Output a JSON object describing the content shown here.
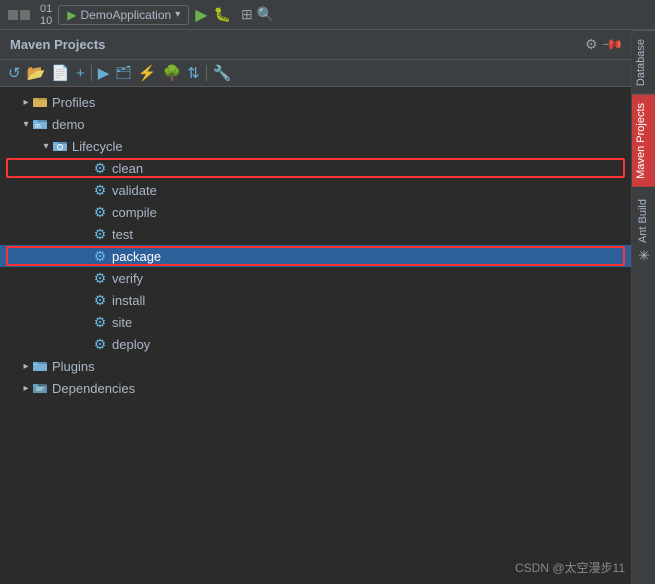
{
  "topbar": {
    "app_name": "DemoApplication",
    "run_label": "▶",
    "debug_label": "🐞"
  },
  "panel": {
    "title": "Maven Projects",
    "gear_label": "⚙",
    "pin_label": "📌"
  },
  "toolbar": {
    "icons": [
      "↺",
      "📂",
      "📄",
      "+",
      "▶",
      "🗂",
      "⚡",
      "🔄",
      "🌳",
      "⇅",
      "🔧"
    ]
  },
  "tree": {
    "items": [
      {
        "id": "profiles",
        "label": "Profiles",
        "indent": 1,
        "type": "folder-profiles",
        "arrow": "closed"
      },
      {
        "id": "demo",
        "label": "demo",
        "indent": 1,
        "type": "folder-demo",
        "arrow": "open"
      },
      {
        "id": "lifecycle",
        "label": "Lifecycle",
        "indent": 2,
        "type": "folder-lifecycle",
        "arrow": "open"
      },
      {
        "id": "clean",
        "label": "clean",
        "indent": 4,
        "type": "gear",
        "arrow": "none",
        "highlight": true
      },
      {
        "id": "validate",
        "label": "validate",
        "indent": 4,
        "type": "gear",
        "arrow": "none"
      },
      {
        "id": "compile",
        "label": "compile",
        "indent": 4,
        "type": "gear",
        "arrow": "none"
      },
      {
        "id": "test",
        "label": "test",
        "indent": 4,
        "type": "gear",
        "arrow": "none"
      },
      {
        "id": "package",
        "label": "package",
        "indent": 4,
        "type": "gear",
        "arrow": "none",
        "selected": true,
        "highlight": true
      },
      {
        "id": "verify",
        "label": "verify",
        "indent": 4,
        "type": "gear",
        "arrow": "none"
      },
      {
        "id": "install",
        "label": "install",
        "indent": 4,
        "type": "gear",
        "arrow": "none"
      },
      {
        "id": "site",
        "label": "site",
        "indent": 4,
        "type": "gear",
        "arrow": "none"
      },
      {
        "id": "deploy",
        "label": "deploy",
        "indent": 4,
        "type": "gear",
        "arrow": "none"
      },
      {
        "id": "plugins",
        "label": "Plugins",
        "indent": 1,
        "type": "folder-plugins",
        "arrow": "closed"
      },
      {
        "id": "dependencies",
        "label": "Dependencies",
        "indent": 1,
        "type": "folder-deps",
        "arrow": "closed"
      }
    ]
  },
  "sidebar": {
    "tabs": [
      {
        "id": "database",
        "label": "Database",
        "active": false
      },
      {
        "id": "maven",
        "label": "Maven Projects",
        "active": true
      },
      {
        "id": "ant",
        "label": "Ant Build",
        "active": false
      }
    ]
  },
  "watermark": {
    "text": "CSDN @太空漫步11"
  }
}
